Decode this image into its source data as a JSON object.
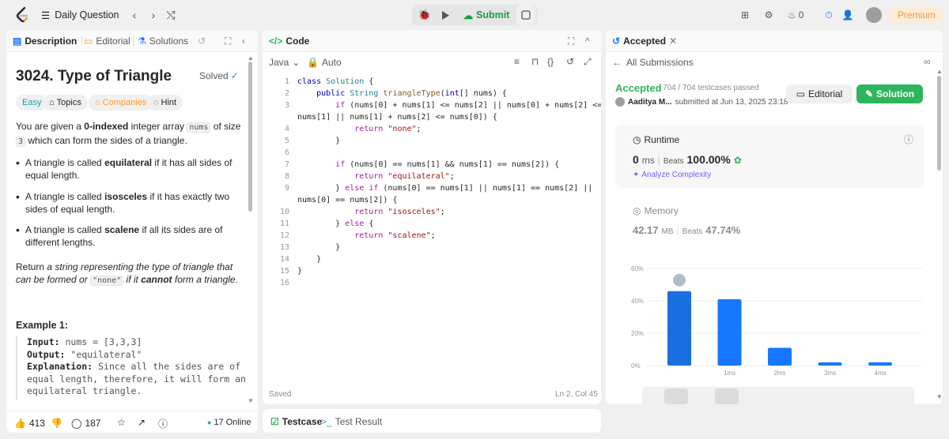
{
  "colors": {
    "accent_green": "#2db55d",
    "brand_orange": "#f39c2b",
    "bar_blue": "#1677ff"
  },
  "topbar": {
    "title": "Daily Question",
    "submit_label": "Submit",
    "streak": "0",
    "premium_label": "Premium"
  },
  "left": {
    "tabs": [
      "Description",
      "Editorial",
      "Solutions"
    ],
    "title": "3024. Type of Triangle",
    "solved": "Solved",
    "chips": [
      "Easy",
      "Topics",
      "Companies",
      "Hint"
    ],
    "desc": {
      "p1a": "You are given a ",
      "p1b": "0-indexed",
      "p1c": " integer array ",
      "p1d": "nums",
      "p1e": " of size ",
      "p1f": "3",
      "p1g": " which can form the sides of a triangle."
    },
    "bullets": [
      {
        "a": "A triangle is called ",
        "b": "equilateral",
        "c": " if it has all sides of equal length."
      },
      {
        "a": "A triangle is called ",
        "b": "isosceles",
        "c": " if it has exactly two sides of equal length."
      },
      {
        "a": "A triangle is called ",
        "b": "scalene",
        "c": " if all its sides are of different lengths."
      }
    ],
    "return_text": {
      "a": "Return ",
      "b": "a string representing",
      "c": " the type of triangle that can be formed or ",
      "d": "\"none\"",
      "e": " if it ",
      "f": "cannot",
      "g": " form a triangle."
    },
    "example_title": "Example 1:",
    "example": {
      "input_label": "Input:",
      "input_value": " nums = [3,3,3]",
      "output_label": "Output:",
      "output_value": " \"equilateral\"",
      "expl_label": "Explanation:",
      "expl_value": " Since all the sides are of equal length, therefore, it will form an equilateral triangle."
    },
    "footer": {
      "likes": "413",
      "comments": "187",
      "online": "17 Online"
    }
  },
  "code": {
    "tab": "Code",
    "language": "Java",
    "auto": "Auto",
    "saved": "Saved",
    "cursor": "Ln 2, Col 45",
    "line_numbers": [
      "1",
      "2",
      "3",
      "4",
      "5",
      "6",
      "7",
      "8",
      "9",
      "10",
      "11",
      "12",
      "13",
      "14",
      "15",
      "16"
    ]
  },
  "bottom": {
    "testcase": "Testcase",
    "result": "Test Result"
  },
  "right": {
    "tab": "Accepted",
    "all_submissions": "All Submissions",
    "status": "Accepted",
    "testcases": "704 / 704 testcases passed",
    "user": "Aaditya M...",
    "submitted": "submitted at Jun 13, 2025 23:18",
    "editorial_btn": "Editorial",
    "solution_btn": "Solution",
    "runtime_label": "Runtime",
    "runtime_value": "0",
    "runtime_unit": "ms",
    "beats_label": "Beats",
    "runtime_beats": "100.00%",
    "analyze": "Analyze Complexity",
    "memory_label": "Memory",
    "memory_value": "42.17",
    "memory_unit": "MB",
    "memory_beats": "47.74%"
  },
  "chart_data": {
    "type": "bar",
    "categories": [
      "",
      "1ms",
      "2ms",
      "3ms",
      "4ms"
    ],
    "values": [
      46,
      41,
      11,
      2,
      2
    ],
    "yticks": [
      "60%",
      "40%",
      "20%",
      "0%"
    ],
    "ylim": [
      0,
      60
    ]
  }
}
